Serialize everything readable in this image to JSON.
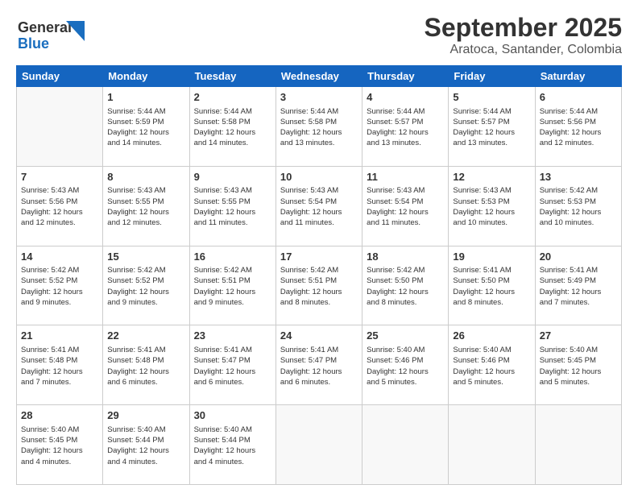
{
  "logo": {
    "line1": "General",
    "line2": "Blue"
  },
  "header": {
    "title": "September 2025",
    "subtitle": "Aratoca, Santander, Colombia"
  },
  "weekdays": [
    "Sunday",
    "Monday",
    "Tuesday",
    "Wednesday",
    "Thursday",
    "Friday",
    "Saturday"
  ],
  "weeks": [
    [
      {
        "day": "",
        "info": ""
      },
      {
        "day": "1",
        "info": "Sunrise: 5:44 AM\nSunset: 5:59 PM\nDaylight: 12 hours\nand 14 minutes."
      },
      {
        "day": "2",
        "info": "Sunrise: 5:44 AM\nSunset: 5:58 PM\nDaylight: 12 hours\nand 14 minutes."
      },
      {
        "day": "3",
        "info": "Sunrise: 5:44 AM\nSunset: 5:58 PM\nDaylight: 12 hours\nand 13 minutes."
      },
      {
        "day": "4",
        "info": "Sunrise: 5:44 AM\nSunset: 5:57 PM\nDaylight: 12 hours\nand 13 minutes."
      },
      {
        "day": "5",
        "info": "Sunrise: 5:44 AM\nSunset: 5:57 PM\nDaylight: 12 hours\nand 13 minutes."
      },
      {
        "day": "6",
        "info": "Sunrise: 5:44 AM\nSunset: 5:56 PM\nDaylight: 12 hours\nand 12 minutes."
      }
    ],
    [
      {
        "day": "7",
        "info": "Sunrise: 5:43 AM\nSunset: 5:56 PM\nDaylight: 12 hours\nand 12 minutes."
      },
      {
        "day": "8",
        "info": "Sunrise: 5:43 AM\nSunset: 5:55 PM\nDaylight: 12 hours\nand 12 minutes."
      },
      {
        "day": "9",
        "info": "Sunrise: 5:43 AM\nSunset: 5:55 PM\nDaylight: 12 hours\nand 11 minutes."
      },
      {
        "day": "10",
        "info": "Sunrise: 5:43 AM\nSunset: 5:54 PM\nDaylight: 12 hours\nand 11 minutes."
      },
      {
        "day": "11",
        "info": "Sunrise: 5:43 AM\nSunset: 5:54 PM\nDaylight: 12 hours\nand 11 minutes."
      },
      {
        "day": "12",
        "info": "Sunrise: 5:43 AM\nSunset: 5:53 PM\nDaylight: 12 hours\nand 10 minutes."
      },
      {
        "day": "13",
        "info": "Sunrise: 5:42 AM\nSunset: 5:53 PM\nDaylight: 12 hours\nand 10 minutes."
      }
    ],
    [
      {
        "day": "14",
        "info": "Sunrise: 5:42 AM\nSunset: 5:52 PM\nDaylight: 12 hours\nand 9 minutes."
      },
      {
        "day": "15",
        "info": "Sunrise: 5:42 AM\nSunset: 5:52 PM\nDaylight: 12 hours\nand 9 minutes."
      },
      {
        "day": "16",
        "info": "Sunrise: 5:42 AM\nSunset: 5:51 PM\nDaylight: 12 hours\nand 9 minutes."
      },
      {
        "day": "17",
        "info": "Sunrise: 5:42 AM\nSunset: 5:51 PM\nDaylight: 12 hours\nand 8 minutes."
      },
      {
        "day": "18",
        "info": "Sunrise: 5:42 AM\nSunset: 5:50 PM\nDaylight: 12 hours\nand 8 minutes."
      },
      {
        "day": "19",
        "info": "Sunrise: 5:41 AM\nSunset: 5:50 PM\nDaylight: 12 hours\nand 8 minutes."
      },
      {
        "day": "20",
        "info": "Sunrise: 5:41 AM\nSunset: 5:49 PM\nDaylight: 12 hours\nand 7 minutes."
      }
    ],
    [
      {
        "day": "21",
        "info": "Sunrise: 5:41 AM\nSunset: 5:48 PM\nDaylight: 12 hours\nand 7 minutes."
      },
      {
        "day": "22",
        "info": "Sunrise: 5:41 AM\nSunset: 5:48 PM\nDaylight: 12 hours\nand 6 minutes."
      },
      {
        "day": "23",
        "info": "Sunrise: 5:41 AM\nSunset: 5:47 PM\nDaylight: 12 hours\nand 6 minutes."
      },
      {
        "day": "24",
        "info": "Sunrise: 5:41 AM\nSunset: 5:47 PM\nDaylight: 12 hours\nand 6 minutes."
      },
      {
        "day": "25",
        "info": "Sunrise: 5:40 AM\nSunset: 5:46 PM\nDaylight: 12 hours\nand 5 minutes."
      },
      {
        "day": "26",
        "info": "Sunrise: 5:40 AM\nSunset: 5:46 PM\nDaylight: 12 hours\nand 5 minutes."
      },
      {
        "day": "27",
        "info": "Sunrise: 5:40 AM\nSunset: 5:45 PM\nDaylight: 12 hours\nand 5 minutes."
      }
    ],
    [
      {
        "day": "28",
        "info": "Sunrise: 5:40 AM\nSunset: 5:45 PM\nDaylight: 12 hours\nand 4 minutes."
      },
      {
        "day": "29",
        "info": "Sunrise: 5:40 AM\nSunset: 5:44 PM\nDaylight: 12 hours\nand 4 minutes."
      },
      {
        "day": "30",
        "info": "Sunrise: 5:40 AM\nSunset: 5:44 PM\nDaylight: 12 hours\nand 4 minutes."
      },
      {
        "day": "",
        "info": ""
      },
      {
        "day": "",
        "info": ""
      },
      {
        "day": "",
        "info": ""
      },
      {
        "day": "",
        "info": ""
      }
    ]
  ]
}
